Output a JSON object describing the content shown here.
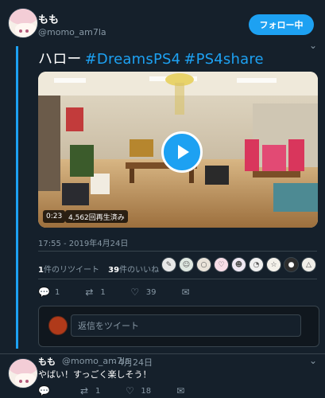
{
  "tweet": {
    "author_name": "もも",
    "author_handle": "@momo_am7la",
    "follow_label": "フォロー中",
    "text": "ハロー",
    "hashtags": [
      "#DreamsPS4",
      "#PS4share"
    ],
    "video": {
      "duration": "0:23",
      "views": "4,562回再生済み"
    },
    "timestamp": "17:55 - 2019年4月24日",
    "stats": {
      "retweets_count": "1",
      "retweets_label": "件のリツイート",
      "likes_count": "39",
      "likes_label": "件のいいね"
    },
    "actions": {
      "reply": "1",
      "retweet": "1",
      "like": "39"
    }
  },
  "reply_box": {
    "placeholder": "返信をツイート"
  },
  "reply": {
    "author_name": "もも",
    "author_handle": "@momo_am7la",
    "date": "· 4月24日",
    "text": "やばい！すっごく楽しそう！",
    "actions": {
      "reply": "",
      "retweet": "1",
      "like": "18"
    }
  },
  "icons": {
    "reply": "reply-icon",
    "retweet": "retweet-icon",
    "like": "heart-icon",
    "dm": "envelope-icon",
    "caret": "chevron-down-icon"
  },
  "colors": {
    "background": "#15202b",
    "accent": "#1da1f2",
    "muted": "#8899a6"
  }
}
